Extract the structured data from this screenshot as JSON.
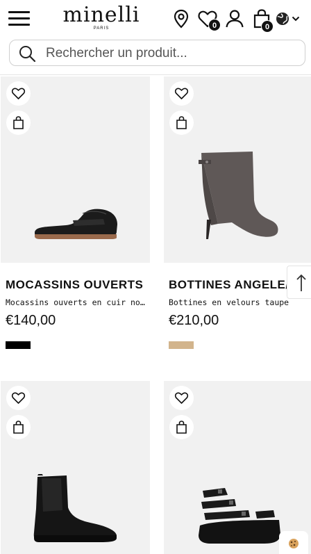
{
  "header": {
    "brand": "minelli",
    "brand_sub": "PARIS",
    "wishlist_count": "0",
    "cart_count": "0"
  },
  "search": {
    "placeholder": "Rechercher un produit..."
  },
  "products": [
    {
      "name": "MOCASSINS OUVERTS",
      "description": "Mocassins ouverts en cuir noir",
      "price": "€140,00",
      "color": "#000000"
    },
    {
      "name": "BOTTINES ANGELE/V",
      "description": "Bottines en velours taupe",
      "price": "€210,00",
      "color": "#d2b48c"
    },
    {
      "name": "",
      "description": "",
      "price": "",
      "color": ""
    },
    {
      "name": "",
      "description": "",
      "price": "",
      "color": ""
    }
  ],
  "colors": {
    "card_bg": "#f1f1f1",
    "text": "#111111"
  },
  "icons": [
    "menu-icon",
    "location-pin-icon",
    "heart-icon",
    "user-icon",
    "shopping-bag-icon",
    "globe-icon",
    "chevron-down-icon",
    "search-icon",
    "arrow-up-icon",
    "cookie-icon"
  ]
}
